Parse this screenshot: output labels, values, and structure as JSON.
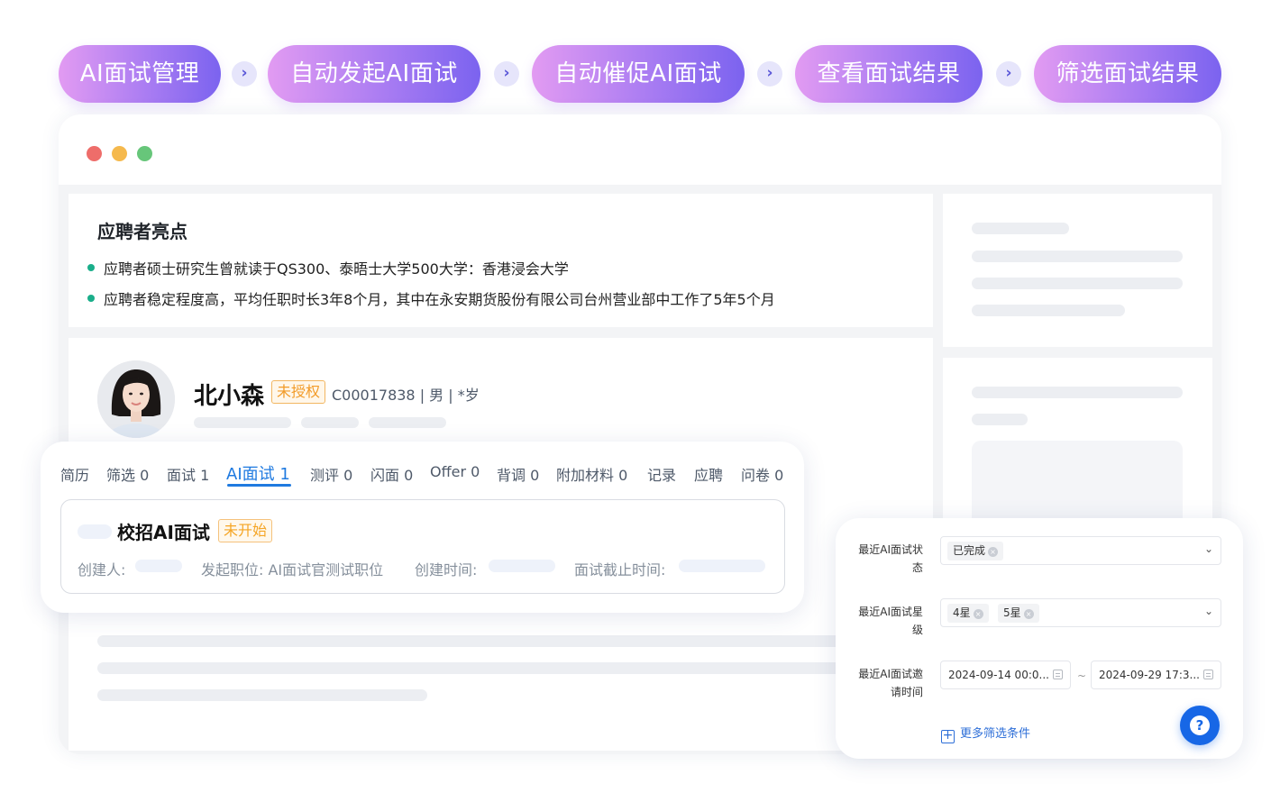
{
  "steps": [
    {
      "label": "AI面试管理"
    },
    {
      "label": "自动发起AI面试"
    },
    {
      "label": "自动催促AI面试"
    },
    {
      "label": "查看面试结果"
    },
    {
      "label": "筛选面试结果"
    }
  ],
  "highlights": {
    "title": "应聘者亮点",
    "items": [
      "应聘者硕士研究生曾就读于QS300、泰晤士大学500大学：香港浸会大学",
      "应聘者稳定程度高，平均任职时长3年8个月，其中在永安期货股份有限公司台州营业部中工作了5年5个月"
    ]
  },
  "candidate": {
    "name": "北小森",
    "auth_tag": "未授权",
    "meta": "C00017838 | 男 | *岁"
  },
  "tabs": [
    "简历",
    "筛选 0",
    "面试 1",
    "AI面试 1",
    "测评 0",
    "闪面 0",
    "Offer 0",
    "背调 0",
    "附加材料 0",
    "记录",
    "应聘",
    "问卷 0"
  ],
  "active_tab": "AI面试 1",
  "interview": {
    "title": "校招AI面试",
    "status": "未开始",
    "creator_label": "创建人:",
    "position_label": "发起职位: AI面试官测试职位",
    "created_label": "创建时间:",
    "deadline_label": "面试截止时间:"
  },
  "filter": {
    "status_label": "最近AI面试状态",
    "status_chips": [
      "已完成"
    ],
    "rating_label": "最近AI面试星级",
    "rating_chips": [
      "4星",
      "5星"
    ],
    "invite_label": "最近AI面试邀请时间",
    "date_start": "2024-09-14 00:0...",
    "date_end": "2024-09-29 17:3...",
    "date_sep": "~",
    "more_label": "更多筛选条件"
  },
  "colors": {
    "pill_gradient_start": "#e29bf2",
    "pill_gradient_end": "#7b63ef",
    "accent_blue": "#1f7ae0",
    "bullet_green": "#1aae8a",
    "tag_orange": "#f29b28"
  },
  "icons": [
    "chevron-right-icon",
    "chevron-down-icon",
    "calendar-icon",
    "plus-square-icon",
    "help-icon",
    "remove-chip-icon"
  ]
}
